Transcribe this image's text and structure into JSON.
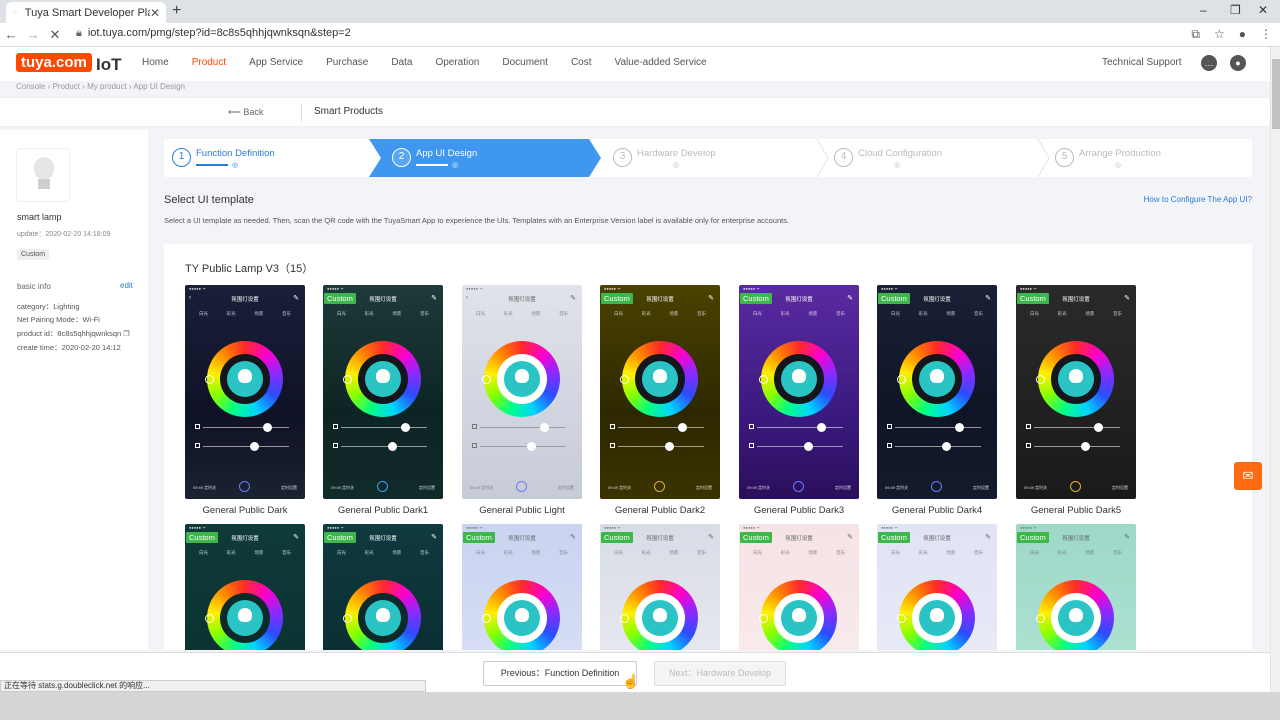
{
  "browser": {
    "tab_title": "Tuya Smart Developer Platform",
    "url": "iot.tuya.com/pmg/step?id=8c8s5qhhjqwnksqn&step=2"
  },
  "header": {
    "logo": "tuya.com",
    "iot": "IoT",
    "nav": [
      "Home",
      "Product",
      "App Service",
      "Purchase",
      "Data",
      "Operation",
      "Document",
      "Cost",
      "Value-added Service"
    ],
    "active_nav": "Product",
    "tech_support": "Technical Support"
  },
  "breadcrumb": "Console  ›  Product  ›  My product  ›  App UI Design",
  "subbar": {
    "back": "Back",
    "title": "Smart Products"
  },
  "device": {
    "name": "smart lamp",
    "update": "update：2020-02-20 14:18:09",
    "tag": "Custom",
    "basic_info": "basic info",
    "edit": "edit",
    "category": "category：Lighting",
    "pairing": "Net Pairing Mode：Wi-Fi",
    "product_id": "product id：8c8s5qhhjqwnksqn",
    "create_time": "create time：2020-02-20 14:12"
  },
  "steps": [
    {
      "num": "1",
      "label": "Function Definition"
    },
    {
      "num": "2",
      "label": "App UI Design"
    },
    {
      "num": "3",
      "label": "Hardware Develop"
    },
    {
      "num": "4",
      "label": "Cloud Configuration"
    },
    {
      "num": "5",
      "label": "Arrange Production"
    }
  ],
  "template": {
    "heading": "Select UI template",
    "howto": "How to Configure The App UI?",
    "note": "Select a UI template as needed. Then, scan the QR code with the TuyaSmart App to experience the UIs. Templates with an Enterprise Version label is available only for enterprise accounts.",
    "group_title": "TY Public Lamp V3（15）",
    "custom_label": "Custom",
    "phone_title": "氛围灯设置",
    "tabs": [
      "白光",
      "彩光",
      "场景",
      "音乐"
    ],
    "bottom_left": "09:49 定时关",
    "bottom_right": "定时设置",
    "row1": [
      "General Public Dark",
      "General Public Dark1",
      "General Public Light",
      "General Public Dark2",
      "General Public Dark3",
      "General Public Dark4",
      "General Public Dark5"
    ]
  },
  "footer": {
    "prev": "Previous：Function Definition",
    "next": "Next：Hardware Develop",
    "status": "正在等待 stats.g.doubleclick.net 的响应..."
  }
}
